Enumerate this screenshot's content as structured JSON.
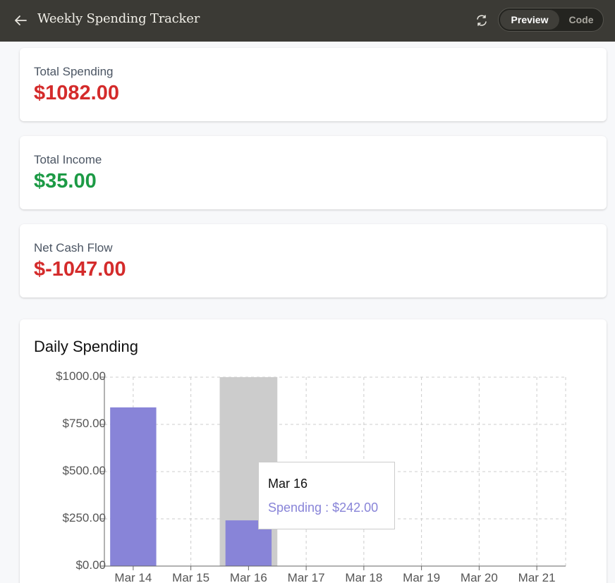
{
  "header": {
    "back_icon": "arrow-left-icon",
    "title": "Weekly Spending Tracker",
    "refresh_icon": "refresh-icon",
    "toggle": {
      "preview": "Preview",
      "code": "Code",
      "active": "Preview"
    }
  },
  "summary": {
    "spending": {
      "label": "Total Spending",
      "value": "$1082.00"
    },
    "income": {
      "label": "Total Income",
      "value": "$35.00"
    },
    "net": {
      "label": "Net Cash Flow",
      "value": "$-1047.00"
    }
  },
  "colors": {
    "negative": "#d42b2b",
    "positive": "#1c9a45",
    "bar": "#8884d8",
    "highlight": "#cccccc"
  },
  "chart_data": {
    "type": "bar",
    "title": "Daily Spending",
    "categories": [
      "Mar 14",
      "Mar 15",
      "Mar 16",
      "Mar 17",
      "Mar 18",
      "Mar 19",
      "Mar 20",
      "Mar 21"
    ],
    "series": [
      {
        "name": "Spending",
        "values": [
          840,
          0,
          242,
          0,
          0,
          0,
          0,
          0
        ]
      }
    ],
    "ylim": [
      0,
      1000
    ],
    "yticks": [
      "$0.00",
      "$250.00",
      "$500.00",
      "$750.00",
      "$1000.00"
    ],
    "ytick_values": [
      0,
      250,
      500,
      750,
      1000
    ],
    "grid": true,
    "highlighted_category": "Mar 16",
    "tooltip": {
      "date": "Mar 16",
      "text": "Spending : $242.00"
    }
  }
}
